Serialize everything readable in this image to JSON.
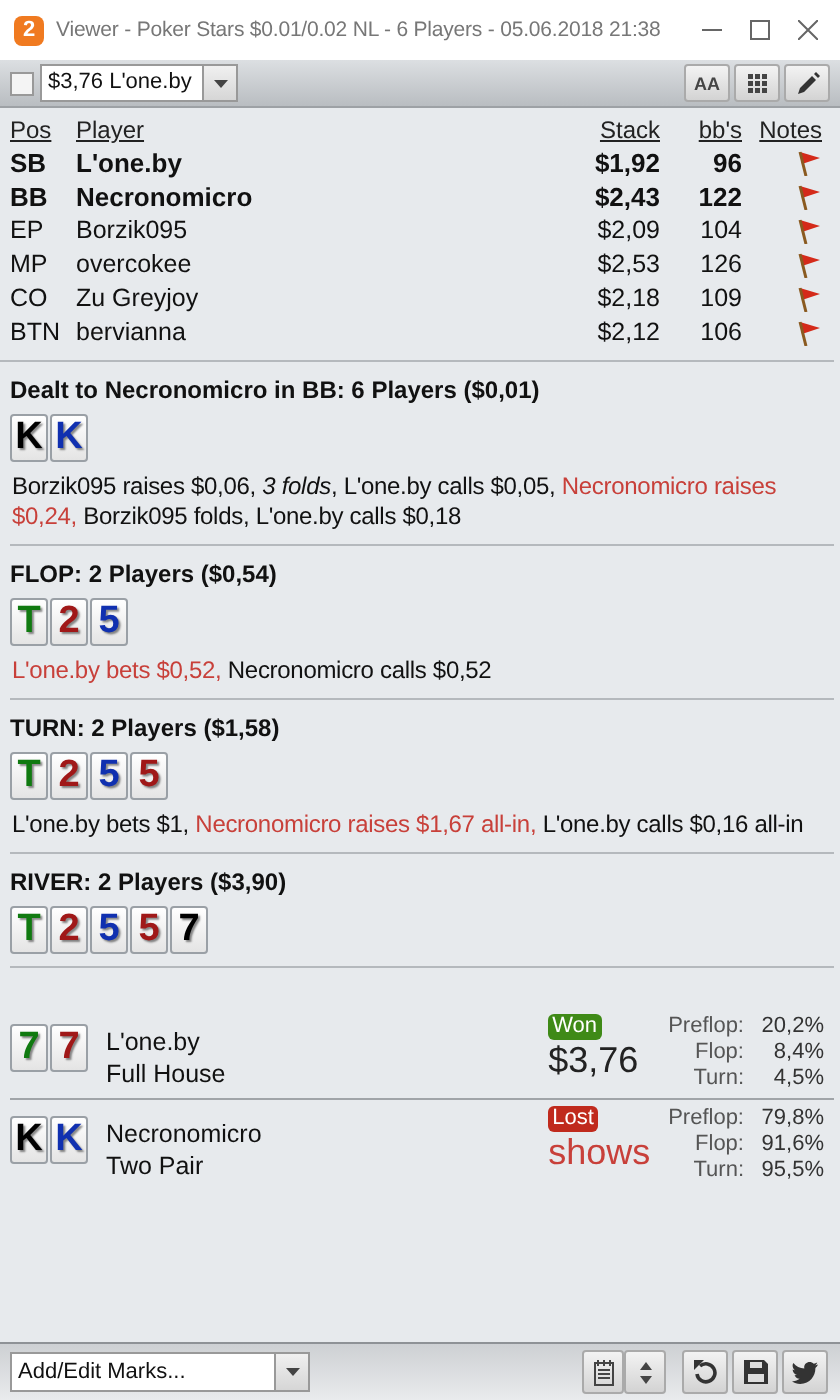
{
  "window": {
    "icon_text": "2",
    "title": "Viewer - Poker Stars $0.01/0.02 NL - 6 Players - 05.06.2018 21:38"
  },
  "toolbar": {
    "checked": false,
    "hand_select": "$3,76 L'one.by",
    "font_button": "AA"
  },
  "players": {
    "columns": [
      "Pos",
      "Player",
      "Stack",
      "bb's",
      "Notes"
    ],
    "rows": [
      {
        "pos": "SB",
        "name": "L'one.by",
        "stack": "$1,92",
        "bbs": "96",
        "in_hand": true
      },
      {
        "pos": "BB",
        "name": "Necronomicro",
        "stack": "$2,43",
        "bbs": "122",
        "in_hand": true
      },
      {
        "pos": "EP",
        "name": "Borzik095",
        "stack": "$2,09",
        "bbs": "104",
        "in_hand": false
      },
      {
        "pos": "MP",
        "name": "overcokee",
        "stack": "$2,53",
        "bbs": "126",
        "in_hand": false
      },
      {
        "pos": "CO",
        "name": "Zu Greyjoy",
        "stack": "$2,18",
        "bbs": "109",
        "in_hand": false
      },
      {
        "pos": "BTN",
        "name": "bervianna",
        "stack": "$2,12",
        "bbs": "106",
        "in_hand": false
      }
    ]
  },
  "streets": [
    {
      "heading": "Dealt to Necronomicro in BB: 6 Players ($0,01)",
      "cards": [
        {
          "rank": "K",
          "color": "#000000"
        },
        {
          "rank": "K",
          "color": "#1030b0"
        }
      ],
      "actions": [
        {
          "text": "Borzik095 raises $0,06, *3 folds*, L'one.by calls $0,05,",
          "highlighted": false
        },
        {
          "text": "Necronomicro raises $0,24,",
          "highlighted": true
        },
        {
          "text": "Borzik095 folds, L'one.by calls $0,18",
          "highlighted": false
        }
      ]
    },
    {
      "heading": "FLOP: 2 Players ($0,54)",
      "cards": [
        {
          "rank": "T",
          "color": "#107a10"
        },
        {
          "rank": "2",
          "color": "#a01818"
        },
        {
          "rank": "5",
          "color": "#1030b0"
        }
      ],
      "actions": [
        {
          "text": "L'one.by bets $0,52,",
          "highlighted": true
        },
        {
          "text": "Necronomicro calls $0,52",
          "highlighted": false
        }
      ]
    },
    {
      "heading": "TURN: 2 Players ($1,58)",
      "cards": [
        {
          "rank": "T",
          "color": "#107a10"
        },
        {
          "rank": "2",
          "color": "#a01818"
        },
        {
          "rank": "5",
          "color": "#1030b0"
        },
        {
          "rank": "5",
          "color": "#a01818"
        }
      ],
      "actions": [
        {
          "text": "L'one.by bets $1,",
          "highlighted": false
        },
        {
          "text": "Necronomicro raises $1,67 all-in,",
          "highlighted": true
        },
        {
          "text": "L'one.by calls $0,16 all-in",
          "highlighted": false
        }
      ]
    },
    {
      "heading": "RIVER: 2 Players ($3,90)",
      "cards": [
        {
          "rank": "T",
          "color": "#107a10"
        },
        {
          "rank": "2",
          "color": "#a01818"
        },
        {
          "rank": "5",
          "color": "#1030b0"
        },
        {
          "rank": "5",
          "color": "#a01818"
        },
        {
          "rank": "7",
          "color": "#000000"
        }
      ]
    }
  ],
  "showdown": [
    {
      "cards": [
        {
          "rank": "7",
          "color": "#107a10"
        },
        {
          "rank": "7",
          "color": "#a01818"
        }
      ],
      "name": "L'one.by",
      "hand": "Full House",
      "kind": "won",
      "badge": "Won",
      "amount": "$3,76",
      "equity": [
        {
          "label": "Preflop:",
          "value": "20,2%"
        },
        {
          "label": "Flop:",
          "value": "8,4%"
        },
        {
          "label": "Turn:",
          "value": "4,5%"
        }
      ]
    },
    {
      "cards": [
        {
          "rank": "K",
          "color": "#000000"
        },
        {
          "rank": "K",
          "color": "#1030b0"
        }
      ],
      "name": "Necronomicro",
      "hand": "Two Pair",
      "kind": "lost",
      "badge": "Lost",
      "amount": "shows",
      "equity": [
        {
          "label": "Preflop:",
          "value": "79,8%"
        },
        {
          "label": "Flop:",
          "value": "91,6%"
        },
        {
          "label": "Turn:",
          "value": "95,5%"
        }
      ]
    }
  ],
  "footer": {
    "marks_select": "Add/Edit Marks..."
  }
}
